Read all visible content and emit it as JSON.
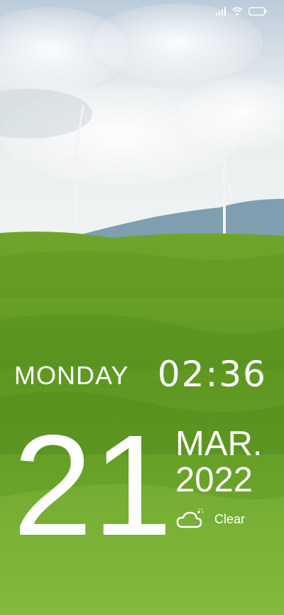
{
  "lockscreen": {
    "weekday": "MONDAY",
    "time": "02:36",
    "day": "21",
    "month": "MAR.",
    "year": "2022",
    "weather": {
      "condition": "Clear",
      "icon": "cloud-sun-icon"
    }
  },
  "status_bar": {
    "icons": [
      "signal-icon",
      "wifi-icon",
      "battery-icon"
    ]
  },
  "wallpaper": {
    "description_colors": {
      "sky": "#dfe8ee",
      "hills": "#6ea52b",
      "mountain": "#7f9fb1"
    }
  }
}
